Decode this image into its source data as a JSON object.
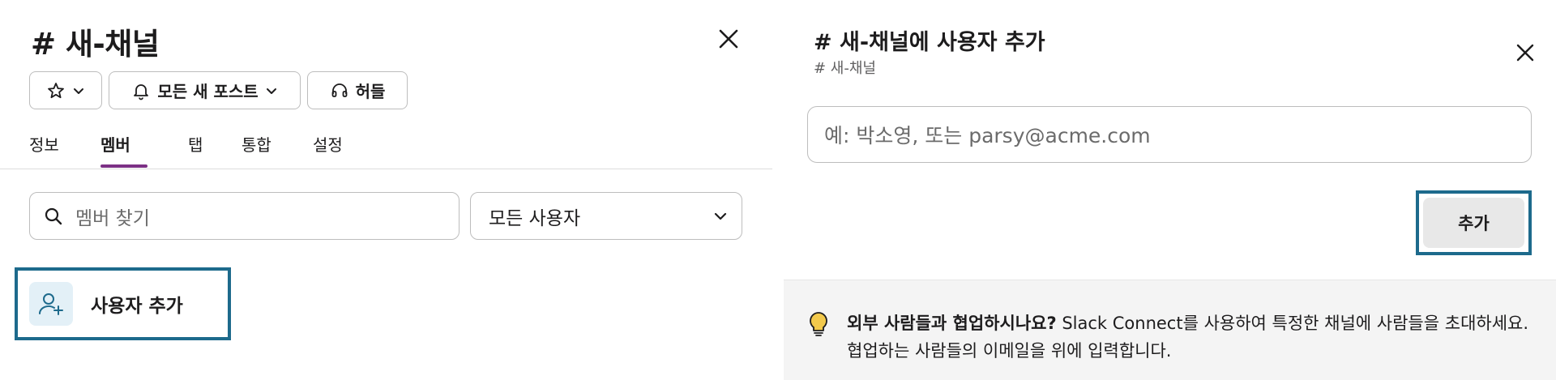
{
  "left": {
    "title": "# 새-채널",
    "toolbar": {
      "star_icon": "star-icon",
      "notifications_label": "모든 새 포스트",
      "huddle_label": "허들"
    },
    "tabs": [
      "정보",
      "멤버",
      "탭",
      "통합",
      "설정"
    ],
    "active_tab": "멤버",
    "search": {
      "placeholder": "멤버 찾기"
    },
    "filter": {
      "selected": "모든 사용자"
    },
    "add_user_label": "사용자 추가"
  },
  "right": {
    "title": "# 새-채널에 사용자 추가",
    "subtitle": "# 새-채널",
    "input_placeholder": "예: 박소영, 또는 parsy@acme.com",
    "add_button": "추가",
    "info": {
      "bold": "외부 사람들과 협업하시나요?",
      "text": " Slack Connect를 사용하여 특정한 채널에 사람들을 초대하세요. 협업하는 사람들의 이메일을 위에 입력합니다."
    }
  },
  "colors": {
    "accent_tab": "#7c3085",
    "highlight_border": "#1d6a8c",
    "add_user_icon_bg": "#e3f0f7",
    "bulb": "#f2c94c"
  }
}
